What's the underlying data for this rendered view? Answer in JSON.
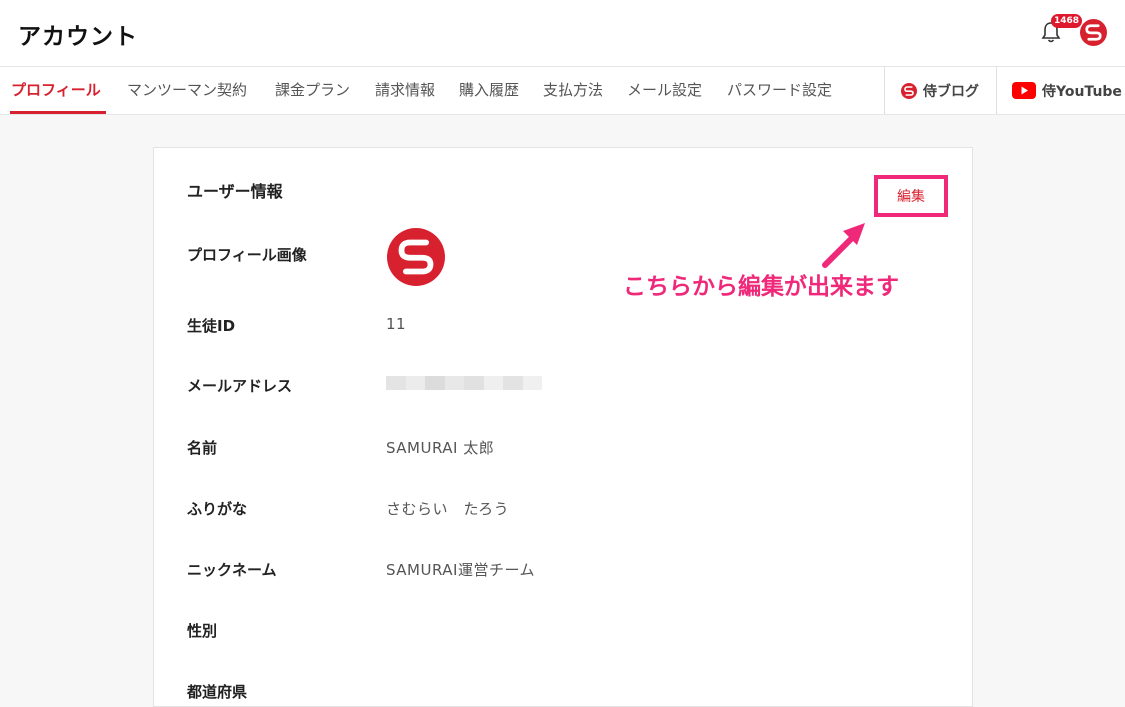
{
  "header": {
    "title": "アカウント",
    "notification_count": "1468"
  },
  "nav": {
    "tabs": [
      {
        "label": "プロフィール",
        "active": true
      },
      {
        "label": "マンツーマン契約"
      },
      {
        "label": "課金プラン"
      },
      {
        "label": "請求情報"
      },
      {
        "label": "購入履歴"
      },
      {
        "label": "支払方法"
      },
      {
        "label": "メール設定"
      },
      {
        "label": "パスワード設定"
      }
    ],
    "blog_label": "侍ブログ",
    "youtube_label": "侍YouTube"
  },
  "card": {
    "section_title": "ユーザー情報",
    "edit_label": "編集",
    "rows": [
      {
        "label": "プロフィール画像",
        "value": ""
      },
      {
        "label": "生徒ID",
        "value": "11"
      },
      {
        "label": "メールアドレス",
        "value": ""
      },
      {
        "label": "名前",
        "value": "SAMURAI 太郎"
      },
      {
        "label": "ふりがな",
        "value": "さむらい　たろう"
      },
      {
        "label": "ニックネーム",
        "value": "SAMURAI運営チーム"
      },
      {
        "label": "性別",
        "value": ""
      },
      {
        "label": "都道府県",
        "value": ""
      }
    ]
  },
  "annotation": "こちらから編集が出来ます",
  "colors": {
    "brand_red": "#d8212f",
    "annotation_pink": "#f0287a",
    "youtube_red": "#ff0000"
  }
}
